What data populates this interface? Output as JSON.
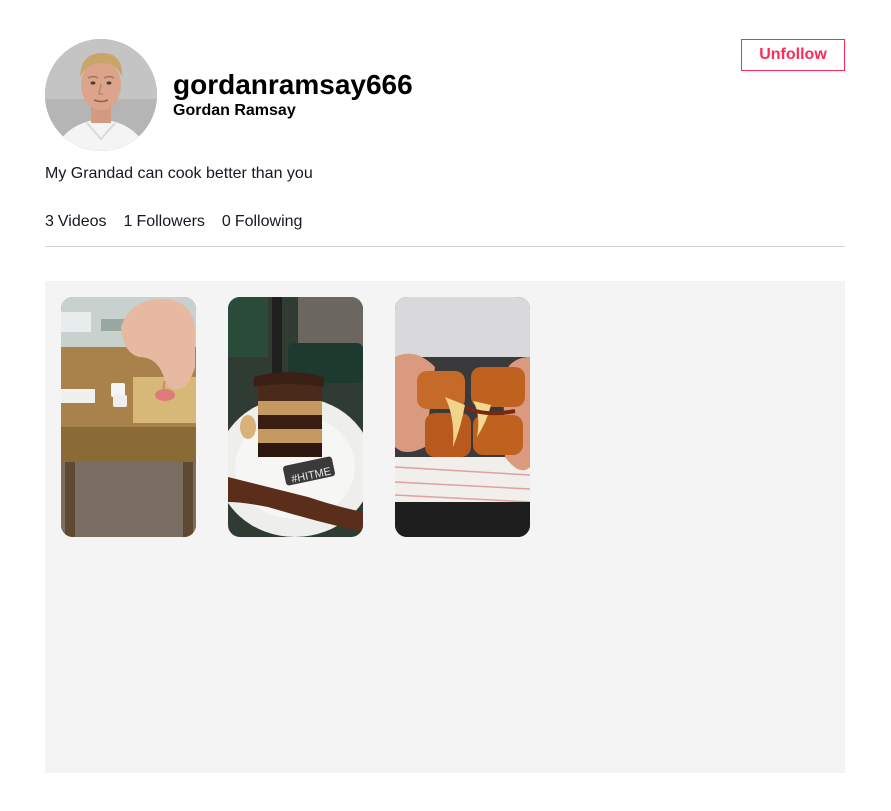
{
  "profile": {
    "username": "gordanramsay666",
    "full_name": "Gordan Ramsay",
    "bio": "My Grandad can cook better than you",
    "avatar_icon": "chef-portrait"
  },
  "actions": {
    "unfollow_label": "Unfollow",
    "accent_color": "#fe2c55"
  },
  "stats": {
    "videos": {
      "count": "3",
      "label": "Videos"
    },
    "followers": {
      "count": "1",
      "label": "Followers"
    },
    "following": {
      "count": "0",
      "label": "Following"
    }
  },
  "videos": [
    {
      "thumbnail": "hand-plating-food-on-wooden-board"
    },
    {
      "thumbnail": "layered-chocolate-cake-slice",
      "overlay_text": "#HITME"
    },
    {
      "thumbnail": "fried-cheese-sandwich-in-hands"
    }
  ]
}
